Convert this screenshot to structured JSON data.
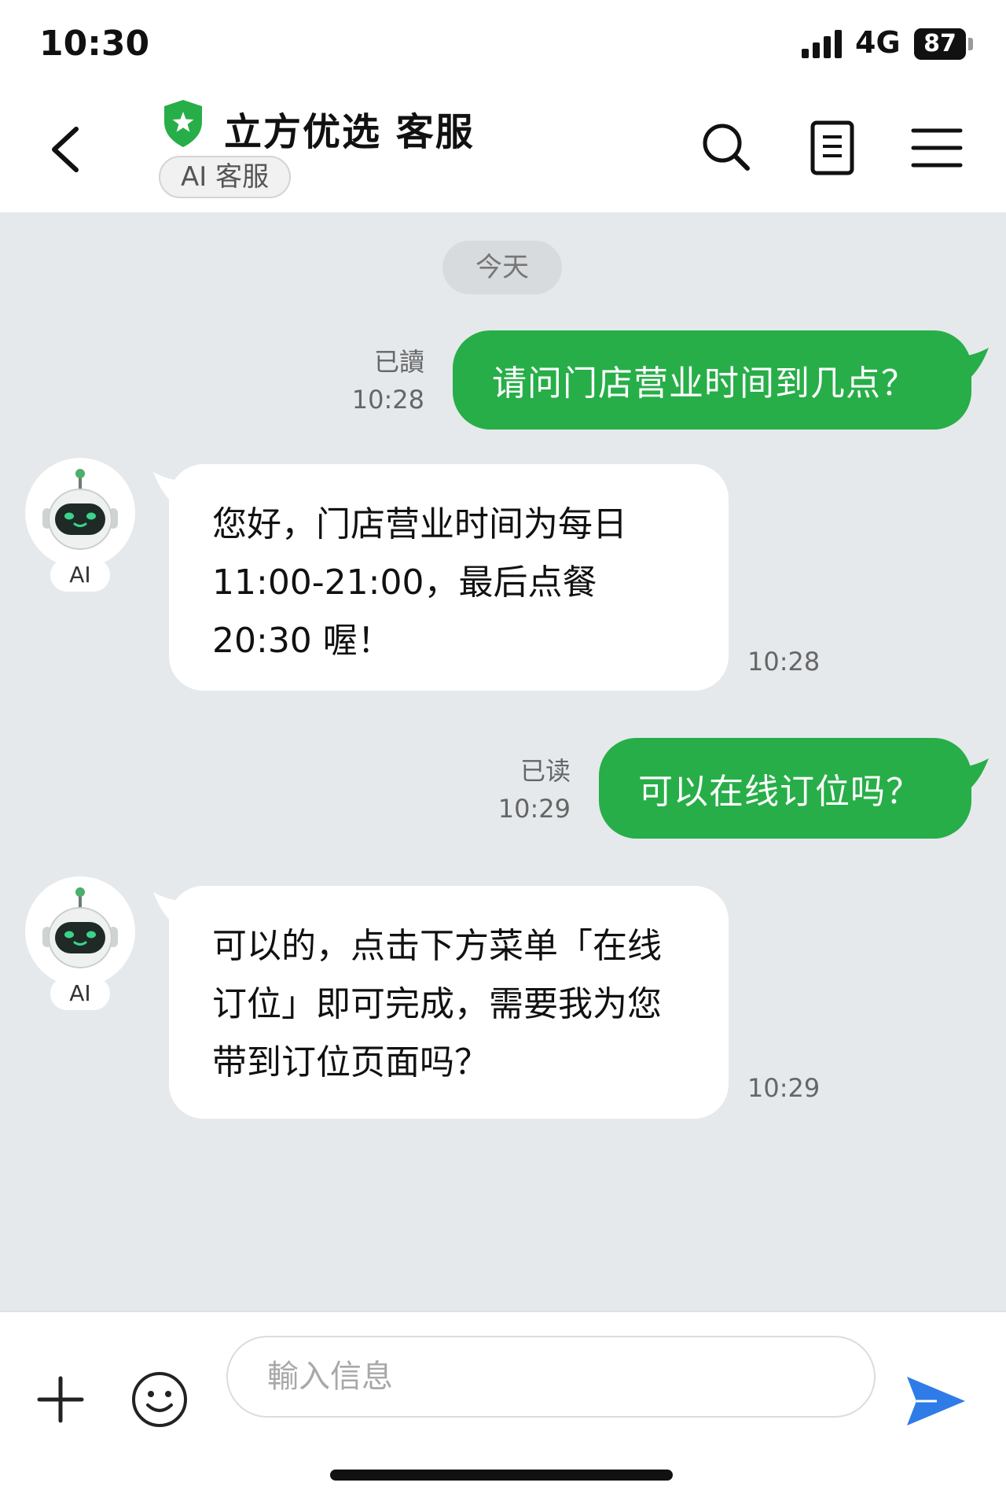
{
  "status_bar": {
    "time": "10:30",
    "network": "4G",
    "battery": "87"
  },
  "header": {
    "title": "立方优选 客服",
    "badge": "AI 客服",
    "icons": [
      "back-icon",
      "shield-icon",
      "search-icon",
      "document-icon",
      "menu-icon"
    ],
    "accent_color": "#27ae48"
  },
  "chat": {
    "date_label": "今天",
    "messages": [
      {
        "sender": "user",
        "text": "请问门店营业时间到几点？",
        "status": "已讀",
        "time": "10:28"
      },
      {
        "sender": "ai",
        "avatar_label": "AI",
        "lines": [
          "您好，门店营业时间为每日",
          "11:00-21:00，最后点餐",
          "20:30 喔！"
        ],
        "time": "10:28"
      },
      {
        "sender": "user",
        "text": "可以在线订位吗？",
        "status": "已读",
        "time": "10:29"
      },
      {
        "sender": "ai",
        "avatar_label": "AI",
        "lines": [
          "可以的，点击下方菜单「在线",
          "订位」即可完成，需要我为您",
          "带到订位页面吗？"
        ],
        "time": "10:29"
      }
    ]
  },
  "input_bar": {
    "placeholder": "輸入信息",
    "icons": [
      "plus-icon",
      "emoji-icon",
      "send-icon"
    ],
    "send_color": "#2f7be8"
  }
}
